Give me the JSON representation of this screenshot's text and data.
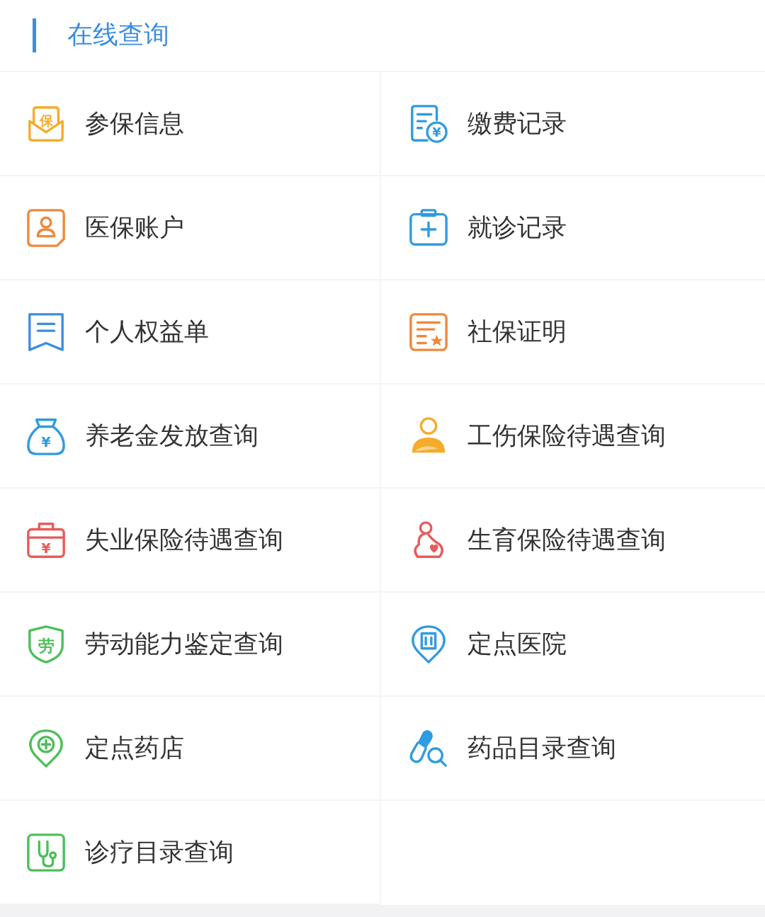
{
  "header": {
    "title": "在线查询"
  },
  "items": [
    {
      "label": "参保信息",
      "color": "#f5ac2a",
      "glyph": "保"
    },
    {
      "label": "缴费记录",
      "color": "#2f9be0",
      "glyph": "¥"
    },
    {
      "label": "医保账户",
      "color": "#f0883a"
    },
    {
      "label": "就诊记录",
      "color": "#2f9be0"
    },
    {
      "label": "个人权益单",
      "color": "#3a8ee0"
    },
    {
      "label": "社保证明",
      "color": "#f0883a"
    },
    {
      "label": "养老金发放查询",
      "color": "#2f9be0",
      "glyph": "¥"
    },
    {
      "label": "工伤保险待遇查询",
      "color": "#f5ac2a"
    },
    {
      "label": "失业保险待遇查询",
      "color": "#ea5a5a",
      "glyph": "¥"
    },
    {
      "label": "生育保险待遇查询",
      "color": "#ea5a5a"
    },
    {
      "label": "劳动能力鉴定查询",
      "color": "#4cbf5a",
      "glyph": "劳"
    },
    {
      "label": "定点医院",
      "color": "#2f9be0"
    },
    {
      "label": "定点药店",
      "color": "#4cbf5a"
    },
    {
      "label": "药品目录查询",
      "color": "#2f9be0"
    },
    {
      "label": "诊疗目录查询",
      "color": "#4cbf5a"
    }
  ]
}
